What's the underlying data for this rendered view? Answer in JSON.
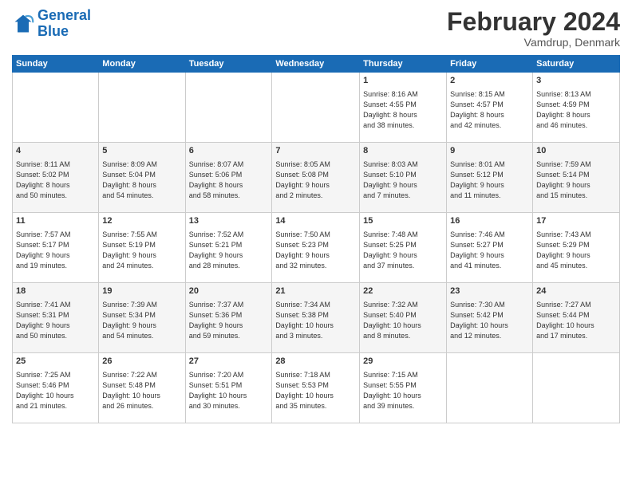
{
  "header": {
    "logo_line1": "General",
    "logo_line2": "Blue",
    "month": "February 2024",
    "location": "Vamdrup, Denmark"
  },
  "days_of_week": [
    "Sunday",
    "Monday",
    "Tuesday",
    "Wednesday",
    "Thursday",
    "Friday",
    "Saturday"
  ],
  "weeks": [
    [
      {
        "day": "",
        "info": ""
      },
      {
        "day": "",
        "info": ""
      },
      {
        "day": "",
        "info": ""
      },
      {
        "day": "",
        "info": ""
      },
      {
        "day": "1",
        "info": "Sunrise: 8:16 AM\nSunset: 4:55 PM\nDaylight: 8 hours\nand 38 minutes."
      },
      {
        "day": "2",
        "info": "Sunrise: 8:15 AM\nSunset: 4:57 PM\nDaylight: 8 hours\nand 42 minutes."
      },
      {
        "day": "3",
        "info": "Sunrise: 8:13 AM\nSunset: 4:59 PM\nDaylight: 8 hours\nand 46 minutes."
      }
    ],
    [
      {
        "day": "4",
        "info": "Sunrise: 8:11 AM\nSunset: 5:02 PM\nDaylight: 8 hours\nand 50 minutes."
      },
      {
        "day": "5",
        "info": "Sunrise: 8:09 AM\nSunset: 5:04 PM\nDaylight: 8 hours\nand 54 minutes."
      },
      {
        "day": "6",
        "info": "Sunrise: 8:07 AM\nSunset: 5:06 PM\nDaylight: 8 hours\nand 58 minutes."
      },
      {
        "day": "7",
        "info": "Sunrise: 8:05 AM\nSunset: 5:08 PM\nDaylight: 9 hours\nand 2 minutes."
      },
      {
        "day": "8",
        "info": "Sunrise: 8:03 AM\nSunset: 5:10 PM\nDaylight: 9 hours\nand 7 minutes."
      },
      {
        "day": "9",
        "info": "Sunrise: 8:01 AM\nSunset: 5:12 PM\nDaylight: 9 hours\nand 11 minutes."
      },
      {
        "day": "10",
        "info": "Sunrise: 7:59 AM\nSunset: 5:14 PM\nDaylight: 9 hours\nand 15 minutes."
      }
    ],
    [
      {
        "day": "11",
        "info": "Sunrise: 7:57 AM\nSunset: 5:17 PM\nDaylight: 9 hours\nand 19 minutes."
      },
      {
        "day": "12",
        "info": "Sunrise: 7:55 AM\nSunset: 5:19 PM\nDaylight: 9 hours\nand 24 minutes."
      },
      {
        "day": "13",
        "info": "Sunrise: 7:52 AM\nSunset: 5:21 PM\nDaylight: 9 hours\nand 28 minutes."
      },
      {
        "day": "14",
        "info": "Sunrise: 7:50 AM\nSunset: 5:23 PM\nDaylight: 9 hours\nand 32 minutes."
      },
      {
        "day": "15",
        "info": "Sunrise: 7:48 AM\nSunset: 5:25 PM\nDaylight: 9 hours\nand 37 minutes."
      },
      {
        "day": "16",
        "info": "Sunrise: 7:46 AM\nSunset: 5:27 PM\nDaylight: 9 hours\nand 41 minutes."
      },
      {
        "day": "17",
        "info": "Sunrise: 7:43 AM\nSunset: 5:29 PM\nDaylight: 9 hours\nand 45 minutes."
      }
    ],
    [
      {
        "day": "18",
        "info": "Sunrise: 7:41 AM\nSunset: 5:31 PM\nDaylight: 9 hours\nand 50 minutes."
      },
      {
        "day": "19",
        "info": "Sunrise: 7:39 AM\nSunset: 5:34 PM\nDaylight: 9 hours\nand 54 minutes."
      },
      {
        "day": "20",
        "info": "Sunrise: 7:37 AM\nSunset: 5:36 PM\nDaylight: 9 hours\nand 59 minutes."
      },
      {
        "day": "21",
        "info": "Sunrise: 7:34 AM\nSunset: 5:38 PM\nDaylight: 10 hours\nand 3 minutes."
      },
      {
        "day": "22",
        "info": "Sunrise: 7:32 AM\nSunset: 5:40 PM\nDaylight: 10 hours\nand 8 minutes."
      },
      {
        "day": "23",
        "info": "Sunrise: 7:30 AM\nSunset: 5:42 PM\nDaylight: 10 hours\nand 12 minutes."
      },
      {
        "day": "24",
        "info": "Sunrise: 7:27 AM\nSunset: 5:44 PM\nDaylight: 10 hours\nand 17 minutes."
      }
    ],
    [
      {
        "day": "25",
        "info": "Sunrise: 7:25 AM\nSunset: 5:46 PM\nDaylight: 10 hours\nand 21 minutes."
      },
      {
        "day": "26",
        "info": "Sunrise: 7:22 AM\nSunset: 5:48 PM\nDaylight: 10 hours\nand 26 minutes."
      },
      {
        "day": "27",
        "info": "Sunrise: 7:20 AM\nSunset: 5:51 PM\nDaylight: 10 hours\nand 30 minutes."
      },
      {
        "day": "28",
        "info": "Sunrise: 7:18 AM\nSunset: 5:53 PM\nDaylight: 10 hours\nand 35 minutes."
      },
      {
        "day": "29",
        "info": "Sunrise: 7:15 AM\nSunset: 5:55 PM\nDaylight: 10 hours\nand 39 minutes."
      },
      {
        "day": "",
        "info": ""
      },
      {
        "day": "",
        "info": ""
      }
    ]
  ]
}
